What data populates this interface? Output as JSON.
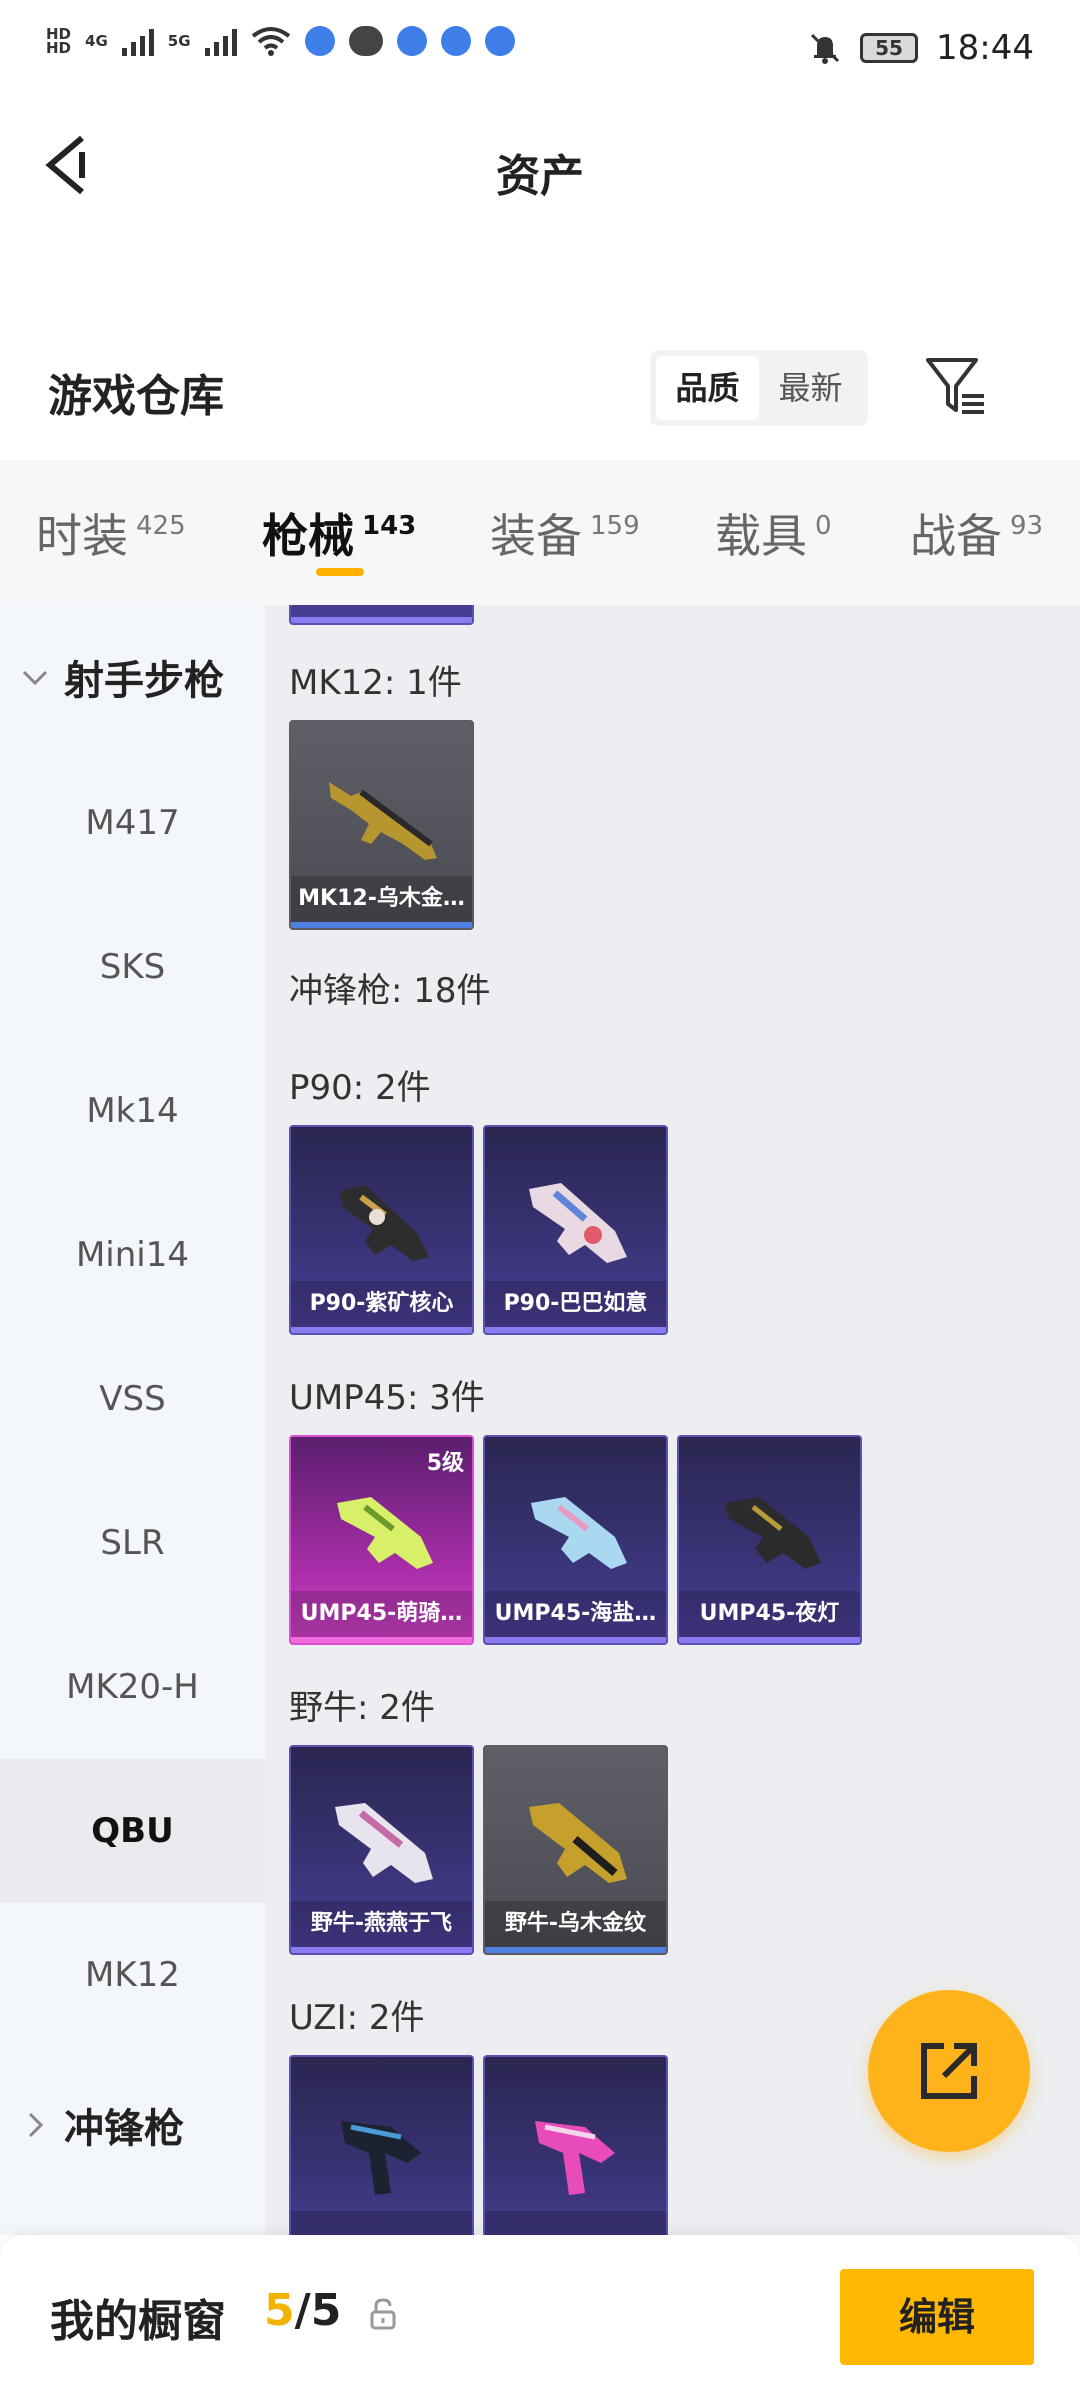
{
  "status_bar": {
    "time": "18:44",
    "battery": "55",
    "network_1": "4G",
    "network_2": "5G",
    "hd_1": "HD",
    "hd_2": "HD"
  },
  "header": {
    "title": "资产",
    "back_icon": "back-arrow-icon"
  },
  "warehouse": {
    "title": "游戏仓库",
    "sort_options": [
      "品质",
      "最新"
    ],
    "active_sort": "品质",
    "filter_icon": "filter-icon"
  },
  "tabs": [
    {
      "label": "时装",
      "count": "425"
    },
    {
      "label": "枪械",
      "count": "143",
      "active": true
    },
    {
      "label": "装备",
      "count": "159"
    },
    {
      "label": "载具",
      "count": "0"
    },
    {
      "label": "战备",
      "count": "93"
    }
  ],
  "sidebar": {
    "group_expanded": "射手步枪",
    "items": [
      "M417",
      "SKS",
      "Mk14",
      "Mini14",
      "VSS",
      "SLR",
      "MK20-H",
      "QBU",
      "MK12"
    ],
    "active_item": "QBU",
    "group_collapsed": "冲锋枪"
  },
  "content": {
    "groups": [
      {
        "title": "MK12: 1件",
        "items": [
          {
            "name": "MK12-乌木金…",
            "rarity": "gray"
          }
        ]
      },
      {
        "title": "冲锋枪: 18件",
        "items": []
      },
      {
        "title": "P90: 2件",
        "items": [
          {
            "name": "P90-紫矿核心",
            "rarity": "purple"
          },
          {
            "name": "P90-巴巴如意",
            "rarity": "purple"
          }
        ]
      },
      {
        "title": "UMP45: 3件",
        "items": [
          {
            "name": "UMP45-萌骑…",
            "rarity": "pink",
            "level": "5级"
          },
          {
            "name": "UMP45-海盐…",
            "rarity": "purple"
          },
          {
            "name": "UMP45-夜灯",
            "rarity": "purple"
          }
        ]
      },
      {
        "title": "野牛: 2件",
        "items": [
          {
            "name": "野牛-燕燕于飞",
            "rarity": "purple"
          },
          {
            "name": "野牛-乌木金纹",
            "rarity": "gray"
          }
        ]
      },
      {
        "title": "UZI: 2件",
        "items": [
          {
            "name": "",
            "rarity": "purple"
          },
          {
            "name": "",
            "rarity": "purple"
          }
        ]
      }
    ]
  },
  "fab": {
    "icon": "share-external-icon"
  },
  "bottom_bar": {
    "label": "我的橱窗",
    "current": "5",
    "separator": "/",
    "total": "5",
    "lock_icon": "lock-icon",
    "edit_label": "编辑"
  },
  "colors": {
    "accent": "#ffb300",
    "rarity_gray": "#5e5f67",
    "rarity_purple": "#3a3478",
    "rarity_pink": "#a32ca4"
  }
}
